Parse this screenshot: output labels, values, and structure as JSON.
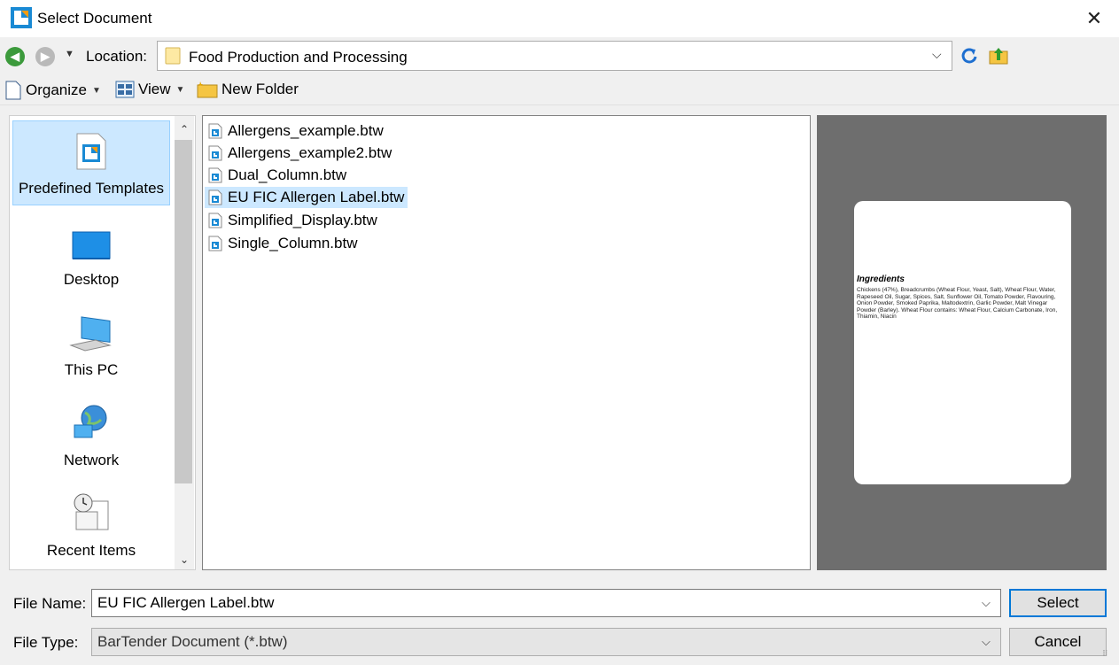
{
  "window": {
    "title": "Select Document",
    "close_glyph": "✕",
    "app_icon": "bartender-icon"
  },
  "location": {
    "label": "Location:",
    "path": "Food Production and Processing"
  },
  "toolbar": {
    "organize": "Organize",
    "view": "View",
    "new_folder": "New Folder"
  },
  "places": [
    {
      "label": "Predefined Templates",
      "icon": "predefined-templates-icon",
      "selected": true
    },
    {
      "label": "Desktop",
      "icon": "desktop-icon"
    },
    {
      "label": "This PC",
      "icon": "this-pc-icon"
    },
    {
      "label": "Network",
      "icon": "network-icon"
    },
    {
      "label": "Recent Items",
      "icon": "recent-items-icon"
    }
  ],
  "files": [
    {
      "name": "Allergens_example.btw"
    },
    {
      "name": "Allergens_example2.btw"
    },
    {
      "name": "Dual_Column.btw"
    },
    {
      "name": "EU FIC Allergen Label.btw",
      "selected": true
    },
    {
      "name": "Simplified_Display.btw"
    },
    {
      "name": "Single_Column.btw"
    }
  ],
  "preview": {
    "title": "Ingredients",
    "body": "Chickens (47%), Breadcrumbs (Wheat Flour, Yeast, Salt), Wheat Flour, Water, Rapeseed Oil, Sugar, Spices, Salt, Sunflower Oil, Tomato Powder, Flavouring, Onion Powder, Smoked Paprika, Maltodextrin, Garlic Powder, Malt Vinegar Powder (Barley). Wheat Flour contains: Wheat Flour, Calcium Carbonate, Iron, Thiamin, Niacin"
  },
  "bottom": {
    "file_name_label": "File Name:",
    "file_name_value": "EU FIC Allergen Label.btw",
    "file_type_label": "File Type:",
    "file_type_value": "BarTender Document (*.btw)",
    "select_button": "Select",
    "cancel_button": "Cancel"
  },
  "colors": {
    "accent": "#0078d7",
    "selection": "#cce8ff",
    "preview_bg": "#6e6e6e"
  }
}
